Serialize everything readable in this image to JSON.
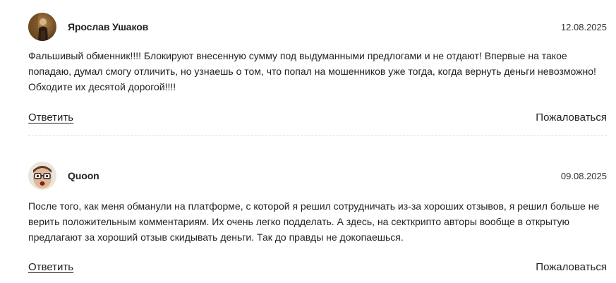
{
  "comments": [
    {
      "author": "Ярослав Ушаков",
      "date": "12.08.2025",
      "avatar_icon": "user-photo-man-standing",
      "text": "Фальшивый обменник!!!! Блокируют внесенную сумму под выдуманными предлогами и не отдают! Впервые на такое попадаю, думал смогу отличить, но узнаешь о том, что попал на мошенников уже тогда, когда вернуть деньги невозможно! Обходите их десятой дорогой!!!!",
      "reply_label": "Ответить",
      "report_label": "Пожаловаться"
    },
    {
      "author": "Quoon",
      "date": "09.08.2025",
      "avatar_icon": "user-photo-man-glasses",
      "text": "После того, как меня обманули на платформе, с которой я решил сотрудничать из-за хороших отзывов, я решил больше не верить положительным комментариям. Их очень легко подделать. А здесь, на секткрипто авторы вообще в открытую предлагают за хороший отзыв скидывать деньги. Так до правды не докопаешься.",
      "reply_label": "Ответить",
      "report_label": "Пожаловаться"
    }
  ]
}
